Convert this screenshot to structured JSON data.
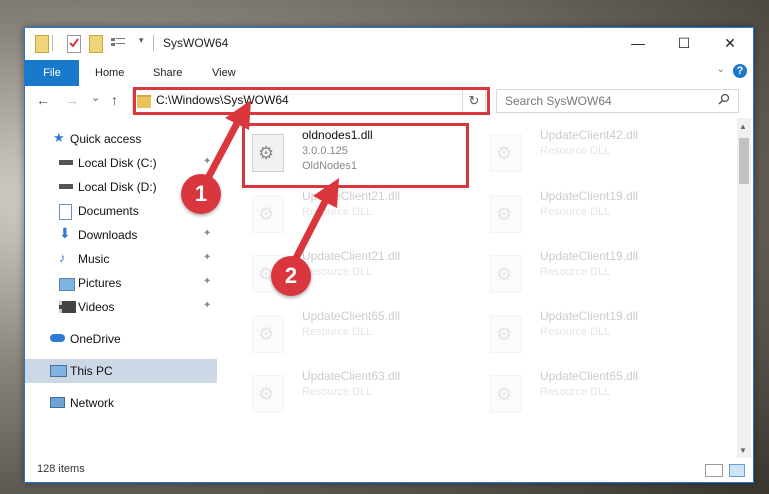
{
  "window": {
    "title": "SysWOW64",
    "minimize": "—",
    "maximize": "☐",
    "close": "✕"
  },
  "ribbon": {
    "file": "File",
    "home": "Home",
    "share": "Share",
    "view": "View",
    "help": "?"
  },
  "nav": {
    "back": "←",
    "forward": "→",
    "recent": "⌄",
    "up": "↑",
    "address": "C:\\Windows\\SysWOW64",
    "refresh": "↻",
    "search_placeholder": "Search SysWOW64",
    "search_icon": "search-icon"
  },
  "sidebar": {
    "items": [
      {
        "label": "Quick access",
        "icon": "star-icon"
      },
      {
        "label": "Local Disk (C:)",
        "icon": "drive-icon"
      },
      {
        "label": "Local Disk (D:)",
        "icon": "drive-icon"
      },
      {
        "label": "Documents",
        "icon": "documents-icon"
      },
      {
        "label": "Downloads",
        "icon": "downloads-icon"
      },
      {
        "label": "Music",
        "icon": "music-icon"
      },
      {
        "label": "Pictures",
        "icon": "pictures-icon"
      },
      {
        "label": "Videos",
        "icon": "videos-icon"
      },
      {
        "label": "OneDrive",
        "icon": "cloud-icon"
      },
      {
        "label": "This PC",
        "icon": "computer-icon"
      },
      {
        "label": "Network",
        "icon": "network-icon"
      }
    ]
  },
  "files": {
    "highlighted": {
      "name": "oldnodes1.dll",
      "version": "3.0.0.125",
      "desc": "OldNodes1"
    },
    "left": [
      {
        "name": "UpdateClient21.dll",
        "type": "Resource DLL"
      },
      {
        "name": "UpdateClient21.dll",
        "type": "Resource DLL"
      },
      {
        "name": "UpdateClient65.dll",
        "type": "Resource DLL"
      },
      {
        "name": "UpdateClient63.dll",
        "type": "Resource DLL"
      }
    ],
    "right": [
      {
        "name": "UpdateClient42.dll",
        "type": "Resource DLL"
      },
      {
        "name": "UpdateClient19.dll",
        "type": "Resource DLL"
      },
      {
        "name": "UpdateClient19.dll",
        "type": "Resource DLL"
      },
      {
        "name": "UpdateClient19.dll",
        "type": "Resource DLL"
      },
      {
        "name": "UpdateClient65.dll",
        "type": "Resource DLL"
      }
    ]
  },
  "status": {
    "count": "128 items"
  },
  "annotations": {
    "one": "1",
    "two": "2",
    "color": "#d9363e"
  }
}
